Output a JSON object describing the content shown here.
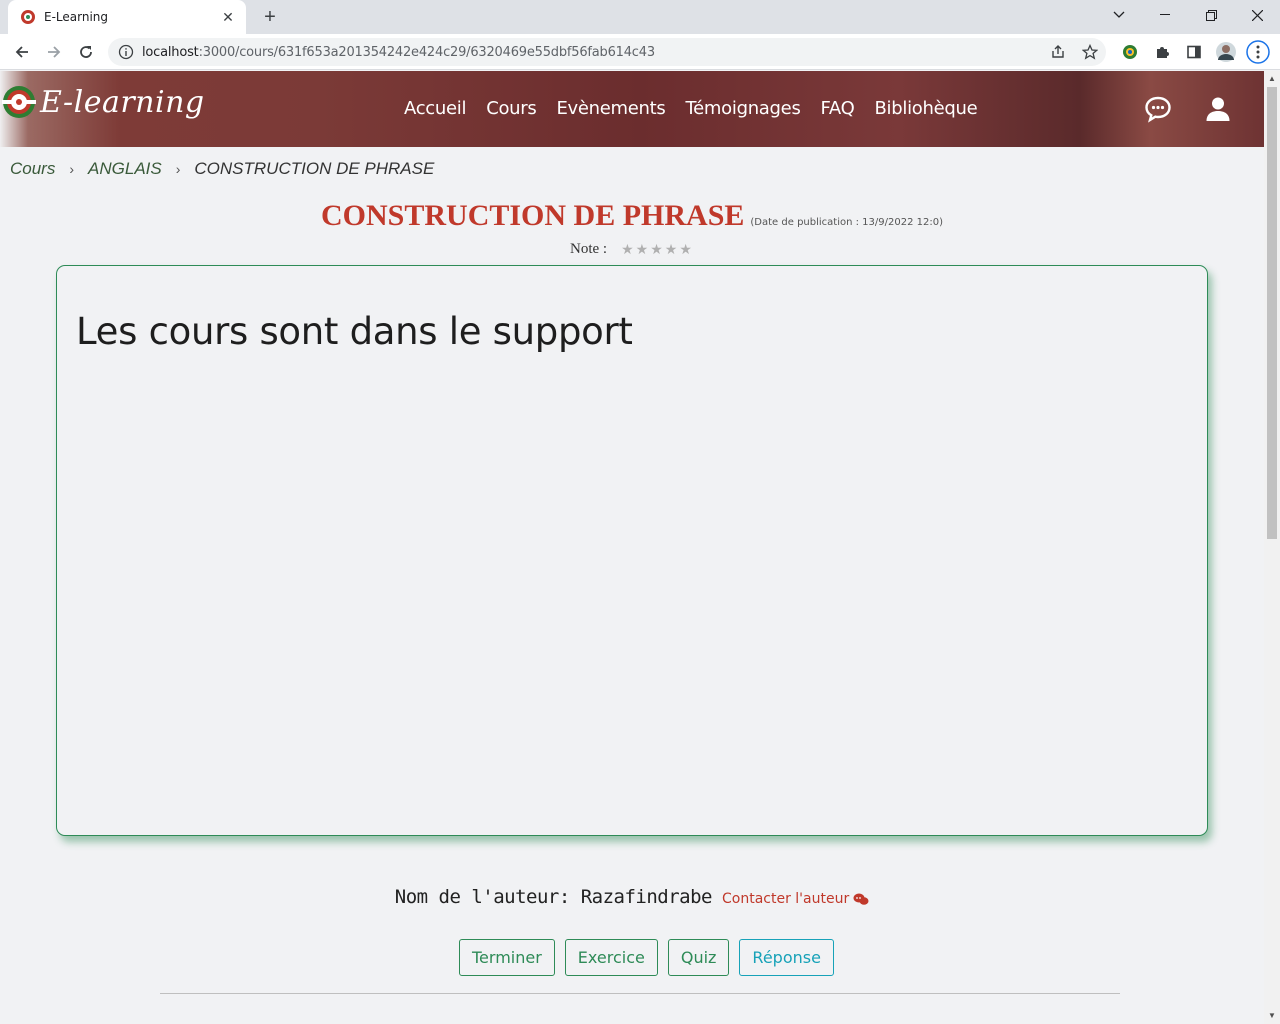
{
  "browser": {
    "tab_title": "E-Learning",
    "tab_close": "✕",
    "new_tab": "+",
    "url_host": "localhost",
    "url_path": ":3000/cours/631f653a201354242e424c29/6320469e55dbf56fab614c43"
  },
  "header": {
    "logo_text": "E-learning",
    "nav": [
      "Accueil",
      "Cours",
      "Evènements",
      "Témoignages",
      "FAQ",
      "Bibliohèque"
    ]
  },
  "breadcrumb": {
    "items": [
      "Cours",
      "ANGLAIS"
    ],
    "current": "CONSTRUCTION DE PHRASE",
    "separator": "›"
  },
  "course": {
    "title": "CONSTRUCTION DE PHRASE",
    "publication": "(Date de publication : 13/9/2022 12:0)",
    "note_label": "Note :",
    "rating": 0,
    "max_rating": 5,
    "content_heading": "Les cours sont dans le support"
  },
  "author": {
    "label": "Nom de l'auteur: Razafindrabe",
    "contact": "Contacter l'auteur"
  },
  "buttons": {
    "finish": "Terminer",
    "exercise": "Exercice",
    "quiz": "Quiz",
    "answer": "Réponse"
  },
  "colors": {
    "header": "#7b3a37",
    "title": "#c0392b",
    "accent_green": "#2e8b57",
    "accent_info": "#17a2b8"
  }
}
